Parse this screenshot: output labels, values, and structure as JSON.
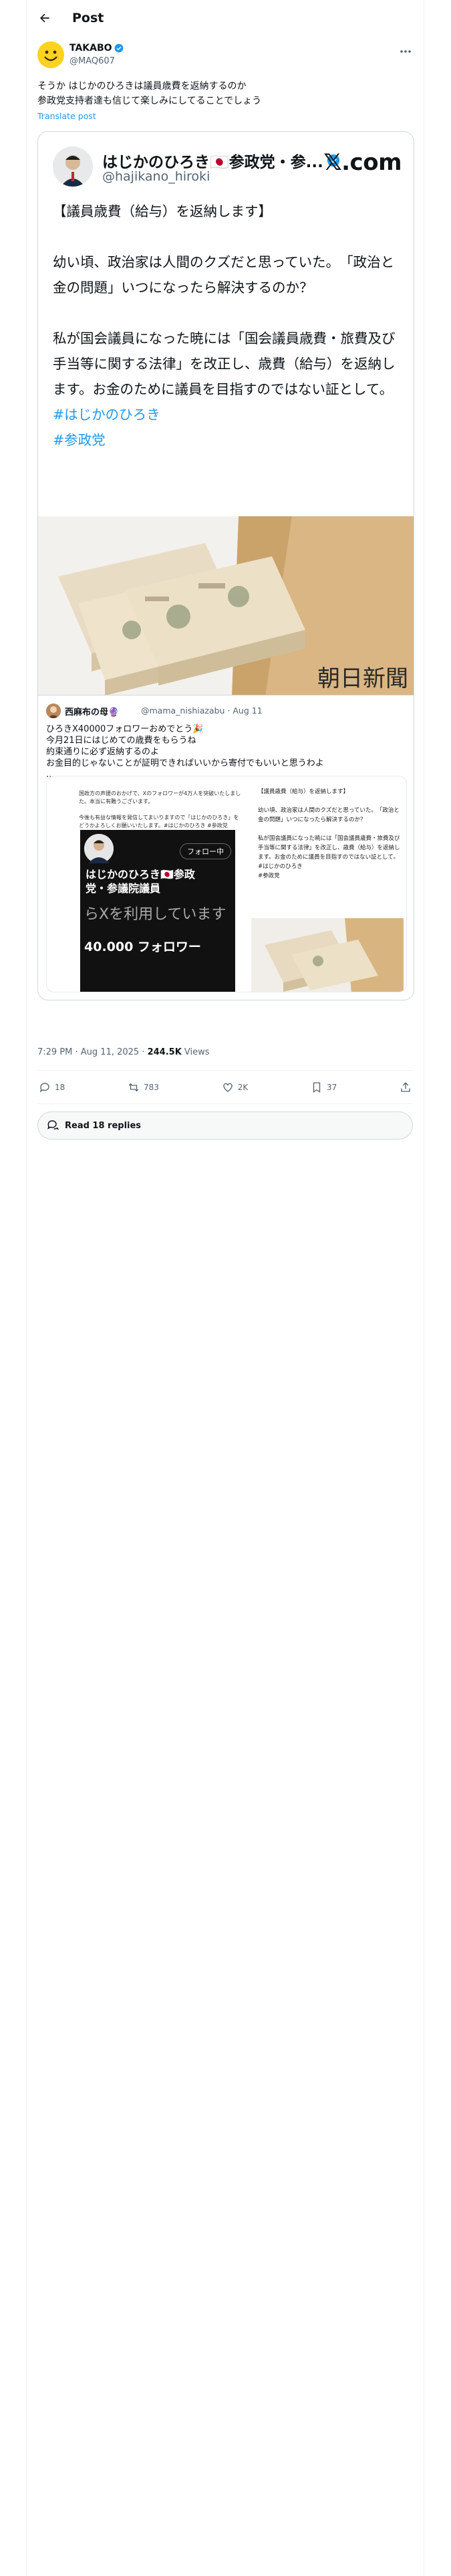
{
  "header": {
    "title": "Post"
  },
  "post": {
    "author_name": "TAKABO",
    "author_handle": "@MAQ607",
    "text": "そうか はじかのひろきは議員歳費を返納するのか\n参政党支持者達も信じて楽しみにしてることでしょう",
    "translate_label": "Translate post",
    "timestamp": "7:29 PM · Aug 11, 2025 · ",
    "views_count": "244.5K",
    "views_label": " Views"
  },
  "embedded_screenshot": {
    "name": "はじかのひろき🇯🇵参政党・参...",
    "handle": "@hajikano_hiroki",
    "x_logo": "𝕏.com",
    "text": "【議員歳費（給与）を返納します】\n\n幼い頃、政治家は人間のクズだと思っていた。　「政治と金の問題」いつになったら解決するのか？\n\n私が国会議員になった暁には「国会議員歳費・旅費及び手当等に関する法律」を改正し、歳費（給与）を返納します。お金のために議員を目指すのではない証として。",
    "hashtag_1": "#はじかのひろき",
    "hashtag_2": "#参政党",
    "watermark": "朝日新聞"
  },
  "quote": {
    "author_name": "西麻布の母🔮",
    "author_handle": "@mama_nishiazabu · Aug 11",
    "text": "ひろきX40000フォロワーおめでとう🎉\n今月21日にはじめての歳費をもらうね\n約束通りに必ず返納するのよ\nお金目的じゃないことが証明できればいいから寄付でもいいと思うわよ\n...",
    "media_left_text": "国政方の声援のおかげで、Xのフォロワーが4万人を突破いたしました。本当に有難うございます。\n\n今後も有益な情報を発信してまいりますので「はじかのひろき」をどうかよろしくお願いいたします。#はじかのひろき #参政党",
    "media_follow_label": "フォロー中",
    "media_profile_name": "はじかのひろき🇯🇵参政\n党・参議院議員",
    "media_use_text": "らXを利用しています",
    "media_follower_count": "40.000 フォロワー",
    "media_right_text": "【議員歳費（給与）を返納します】\n\n幼い頃、政治家は人間のクズだと思っていた。　「政治と金の問題」いつになったら解決するのか？\n\n私が国会議員になった暁には「国会議員歳費・旅費及び手当等に関する法律」を改正し、歳費（給与）を返納します。お金のために議員を目指すのではない証として。\n#はじかのひろき\n#参政党"
  },
  "actions": {
    "replies": "18",
    "reposts": "783",
    "likes": "2K",
    "bookmarks": "37"
  },
  "read_replies_label": "Read 18 replies",
  "colors": {
    "accent": "#1d9bf0",
    "verified": "#1d9bf0",
    "muted": "#536471"
  }
}
